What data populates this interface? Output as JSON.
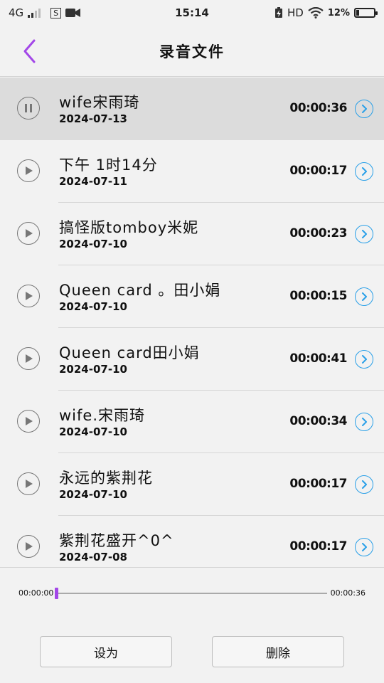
{
  "status_bar": {
    "network": "4G",
    "sim_icon": "S",
    "time": "15:14",
    "hd": "HD",
    "battery_percent": "12%"
  },
  "header": {
    "title": "录音文件"
  },
  "recordings": [
    {
      "name": "wife宋雨琦",
      "date": "2024-07-13",
      "duration": "00:00:36",
      "state": "playing"
    },
    {
      "name": "下午 1时14分",
      "date": "2024-07-11",
      "duration": "00:00:17",
      "state": "stopped"
    },
    {
      "name": "搞怪版tomboy米妮",
      "date": "2024-07-10",
      "duration": "00:00:23",
      "state": "stopped"
    },
    {
      "name": "Queen card 。田小娟",
      "date": "2024-07-10",
      "duration": "00:00:15",
      "state": "stopped"
    },
    {
      "name": "Queen card田小娟",
      "date": "2024-07-10",
      "duration": "00:00:41",
      "state": "stopped"
    },
    {
      "name": "wife.宋雨琦",
      "date": "2024-07-10",
      "duration": "00:00:34",
      "state": "stopped"
    },
    {
      "name": "永远的紫荆花",
      "date": "2024-07-10",
      "duration": "00:00:17",
      "state": "stopped"
    },
    {
      "name": "紫荆花盛开^0^",
      "date": "2024-07-08",
      "duration": "00:00:17",
      "state": "stopped"
    }
  ],
  "player": {
    "current_time": "00:00:00",
    "total_time": "00:00:36",
    "progress_fraction": 0
  },
  "actions": {
    "set_as": "设为",
    "delete": "删除"
  },
  "colors": {
    "accent": "#a347e8",
    "detail_icon": "#2aa0e8",
    "active_row": "#dcdcdc",
    "background": "#f2f2f2"
  }
}
